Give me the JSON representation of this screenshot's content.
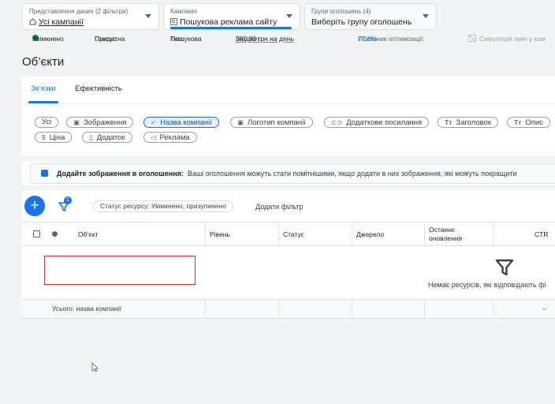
{
  "selectors": {
    "data_view": {
      "label": "Представлення даних (2 фільтри)",
      "value": "Усі кампанії"
    },
    "campaign": {
      "label": "Кампанія",
      "value": "Пошукова реклама сайту"
    },
    "ad_group": {
      "label": "Групи оголошень (4)",
      "value": "Виберіть групу оголошень"
    }
  },
  "status_line": {
    "enabled": "Увімкнено",
    "status_label": "Статус:",
    "status_value": "Придатна",
    "type_label": "Тип:",
    "type_value": "Пошукова",
    "budget_label": "Бюджет:",
    "budget_value": "360,00 грн на день",
    "optimization_label": "Показник оптимізації:",
    "optimization_value": "77,8%",
    "simulation": "Симуляція змін у кам"
  },
  "page_title": "Об’єкти",
  "tabs": [
    {
      "label": "Зв’язки",
      "active": true
    },
    {
      "label": "Ефективність",
      "active": false
    }
  ],
  "chips": [
    {
      "label": "Усі",
      "icon": "",
      "selected": false
    },
    {
      "label": "Зображення",
      "icon": "image-icon",
      "selected": false
    },
    {
      "label": "Назва компанії",
      "icon": "check-icon",
      "selected": true
    },
    {
      "label": "Логотип компанії",
      "icon": "logo-icon",
      "selected": false
    },
    {
      "label": "Додаткове посилання",
      "icon": "link-icon",
      "selected": false
    },
    {
      "label": "Заголовок",
      "icon": "headline-icon",
      "selected": false
    },
    {
      "label": "Опис",
      "icon": "description-icon",
      "selected": false
    },
    {
      "label": "Ціна",
      "icon": "price-icon",
      "selected": false
    },
    {
      "label": "Додаток",
      "icon": "app-icon",
      "selected": false
    },
    {
      "label": "Реклама",
      "icon": "promotion-icon",
      "selected": false
    }
  ],
  "banner": {
    "title": "Додайте зображення в оголошення:",
    "text": "Ваші оголошення можуть стати помітнішими, якщо додати в них зображення, які можуть покращити"
  },
  "toolbar": {
    "add": "+",
    "filter_count": "1",
    "filter_chip": "Статус ресурсу: Увімкнено, призупинено",
    "add_filter": "Додати фільтр"
  },
  "table": {
    "columns": [
      "Об’єкт",
      "Рівень",
      "Статус",
      "Джерело",
      "Останнє оновлення",
      "CTR"
    ],
    "empty_message": "Немає ресурсів, які відповідають фі",
    "total_label": "Усього: назва компанії",
    "total_ctr": "–"
  },
  "colors": {
    "accent": "#1a73e8",
    "enabled": "#188038",
    "highlight": "#d93025"
  }
}
